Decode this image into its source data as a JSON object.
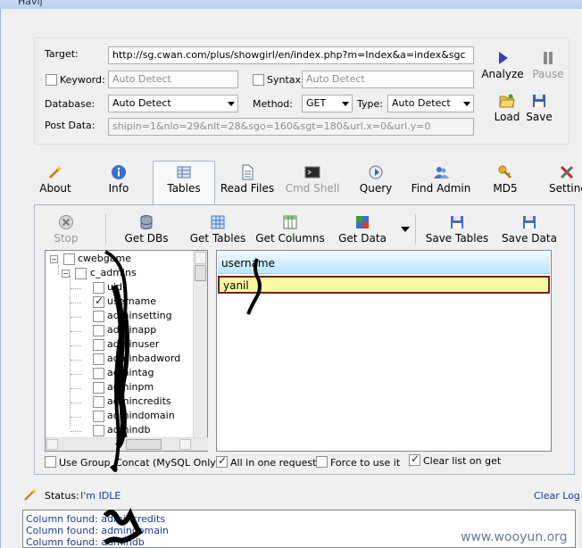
{
  "window": {
    "title": "Havij"
  },
  "target": {
    "label": "Target:",
    "value": "http://sg.cwan.com/plus/showgirl/en/index.php?m=Index&a=index&sgc"
  },
  "keyword": {
    "label": "Keyword:",
    "placeholder": "Auto Detect"
  },
  "syntax": {
    "label": "Syntax:",
    "placeholder": "Auto Detect"
  },
  "database": {
    "label": "Database:",
    "value": "Auto Detect"
  },
  "method": {
    "label": "Method:",
    "value": "GET"
  },
  "type": {
    "label": "Type:",
    "value": "Auto Detect"
  },
  "post_data": {
    "label": "Post Data:",
    "value": "shipin=1&nlo=29&nlt=28&sgo=160&sgt=180&url.x=0&url.y=0"
  },
  "actions": {
    "analyze": "Analyze",
    "pause": "Pause",
    "load": "Load",
    "save": "Save"
  },
  "tabs": [
    {
      "label": "About"
    },
    {
      "label": "Info"
    },
    {
      "label": "Tables"
    },
    {
      "label": "Read Files"
    },
    {
      "label": "Cmd Shell"
    },
    {
      "label": "Query"
    },
    {
      "label": "Find Admin"
    },
    {
      "label": "MD5"
    },
    {
      "label": "Settings"
    }
  ],
  "toolbar": {
    "stop": "Stop",
    "get_dbs": "Get DBs",
    "get_tables": "Get Tables",
    "get_columns": "Get Columns",
    "get_data": "Get Data",
    "save_tables": "Save Tables",
    "save_data": "Save Data"
  },
  "tree": {
    "db": "cwebgame",
    "table": "c_admins",
    "columns": [
      {
        "label": "uid",
        "checked": false
      },
      {
        "label": "username",
        "checked": true
      },
      {
        "label": "adminsetting",
        "checked": false
      },
      {
        "label": "adminapp",
        "checked": false
      },
      {
        "label": "adminuser",
        "checked": false
      },
      {
        "label": "adminbadword",
        "checked": false
      },
      {
        "label": "admintag",
        "checked": false
      },
      {
        "label": "adminpm",
        "checked": false
      },
      {
        "label": "admincredits",
        "checked": false
      },
      {
        "label": "admindomain",
        "checked": false
      },
      {
        "label": "admindb",
        "checked": false
      }
    ]
  },
  "grid": {
    "header": "username",
    "rows": [
      "yanil"
    ]
  },
  "options": {
    "group_concat": "Use Group_Concat (MySQL Only)",
    "all_in_one": "All in one request.",
    "force": "Force to use it",
    "clear_list": "Clear list on get"
  },
  "status": {
    "label": "Status:",
    "value": "I'm IDLE",
    "clear_log": "Clear Log"
  },
  "log": [
    "Column found: admincredits",
    "Column found: admindomain",
    "Column found: admindb"
  ],
  "watermark": "www.wooyun.org"
}
